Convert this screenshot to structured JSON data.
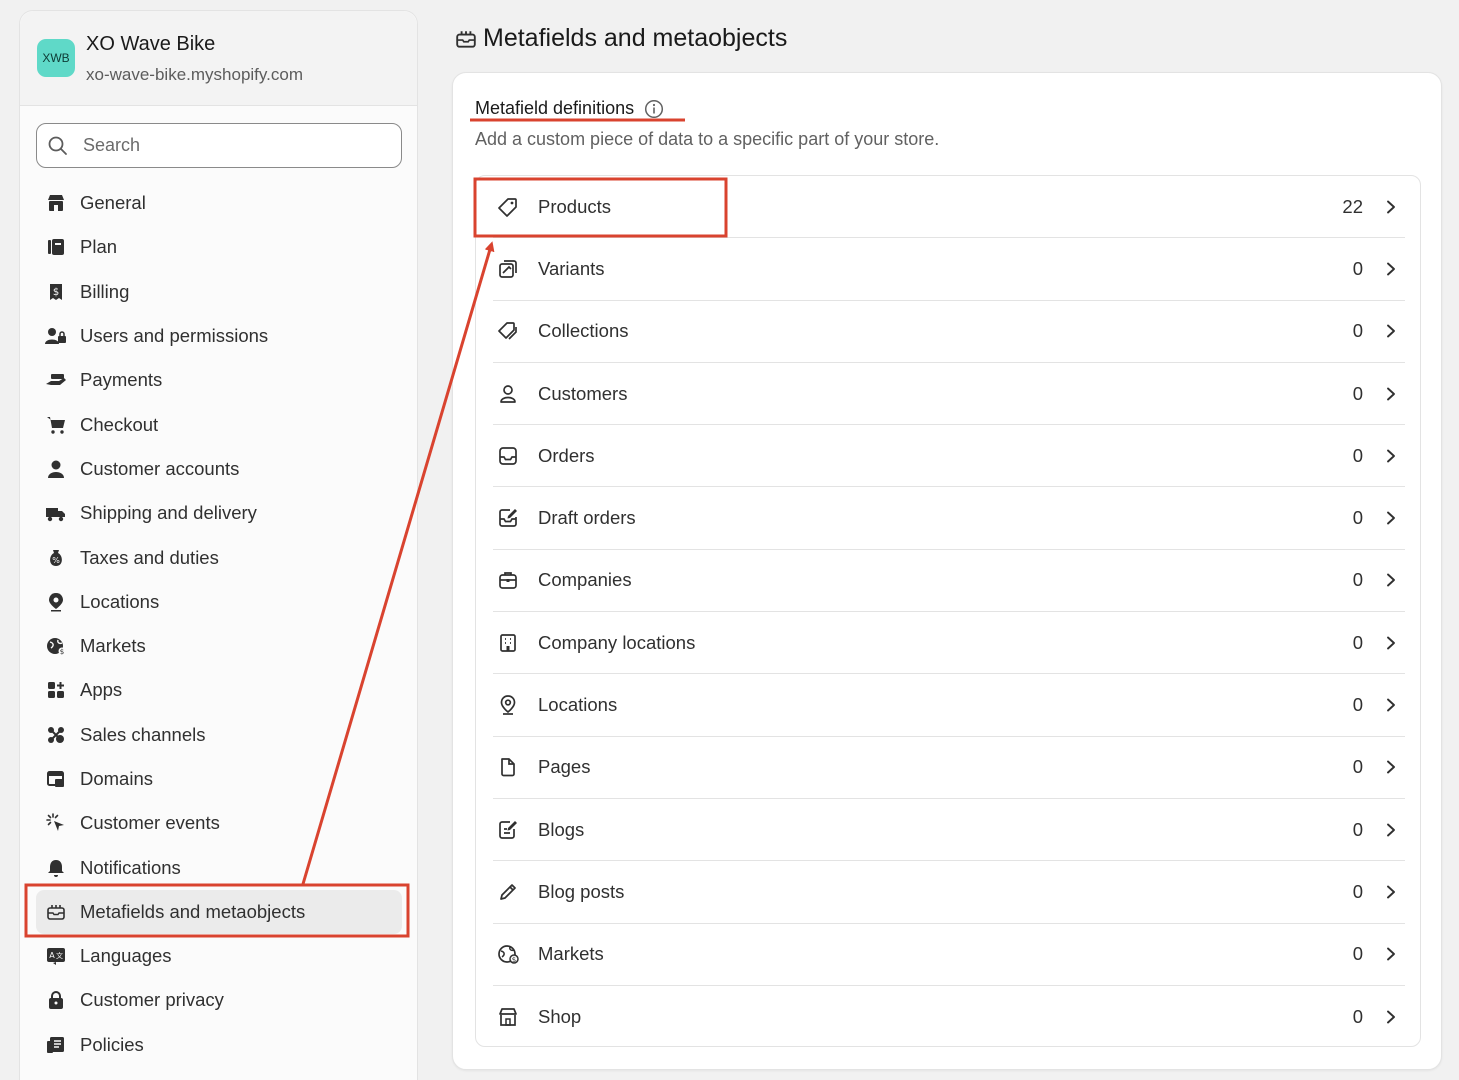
{
  "store": {
    "badge": "XWB",
    "name": "XO Wave Bike",
    "domain": "xo-wave-bike.myshopify.com"
  },
  "search": {
    "placeholder": "Search"
  },
  "nav": {
    "items": [
      {
        "label": "General",
        "icon": "store-icon"
      },
      {
        "label": "Plan",
        "icon": "plan-icon"
      },
      {
        "label": "Billing",
        "icon": "billing-icon"
      },
      {
        "label": "Users and permissions",
        "icon": "users-icon"
      },
      {
        "label": "Payments",
        "icon": "payments-icon"
      },
      {
        "label": "Checkout",
        "icon": "cart-icon"
      },
      {
        "label": "Customer accounts",
        "icon": "person-icon"
      },
      {
        "label": "Shipping and delivery",
        "icon": "truck-icon"
      },
      {
        "label": "Taxes and duties",
        "icon": "tax-icon"
      },
      {
        "label": "Locations",
        "icon": "location-icon"
      },
      {
        "label": "Markets",
        "icon": "globe-icon"
      },
      {
        "label": "Apps",
        "icon": "apps-icon"
      },
      {
        "label": "Sales channels",
        "icon": "channels-icon"
      },
      {
        "label": "Domains",
        "icon": "domains-icon"
      },
      {
        "label": "Customer events",
        "icon": "events-icon"
      },
      {
        "label": "Notifications",
        "icon": "bell-icon"
      },
      {
        "label": "Metafields and metaobjects",
        "icon": "metafields-icon",
        "active": true
      },
      {
        "label": "Languages",
        "icon": "languages-icon"
      },
      {
        "label": "Customer privacy",
        "icon": "lock-icon"
      },
      {
        "label": "Policies",
        "icon": "policies-icon"
      }
    ]
  },
  "main": {
    "title": "Metafields and metaobjects",
    "card": {
      "title": "Metafield definitions",
      "subtitle": "Add a custom piece of data to a specific part of your store.",
      "rows": [
        {
          "label": "Products",
          "count": "22",
          "icon": "tag-icon"
        },
        {
          "label": "Variants",
          "count": "0",
          "icon": "variants-icon"
        },
        {
          "label": "Collections",
          "count": "0",
          "icon": "collections-icon"
        },
        {
          "label": "Customers",
          "count": "0",
          "icon": "person-icon"
        },
        {
          "label": "Orders",
          "count": "0",
          "icon": "inbox-icon"
        },
        {
          "label": "Draft orders",
          "count": "0",
          "icon": "draft-order-icon"
        },
        {
          "label": "Companies",
          "count": "0",
          "icon": "briefcase-icon"
        },
        {
          "label": "Company locations",
          "count": "0",
          "icon": "building-icon"
        },
        {
          "label": "Locations",
          "count": "0",
          "icon": "location-icon"
        },
        {
          "label": "Pages",
          "count": "0",
          "icon": "page-icon"
        },
        {
          "label": "Blogs",
          "count": "0",
          "icon": "blog-icon"
        },
        {
          "label": "Blog posts",
          "count": "0",
          "icon": "pencil-icon"
        },
        {
          "label": "Markets",
          "count": "0",
          "icon": "globe-icon"
        },
        {
          "label": "Shop",
          "count": "0",
          "icon": "store-icon"
        }
      ]
    }
  },
  "colors": {
    "annotation": "#d9432f",
    "badge": "#5fd9c8"
  }
}
